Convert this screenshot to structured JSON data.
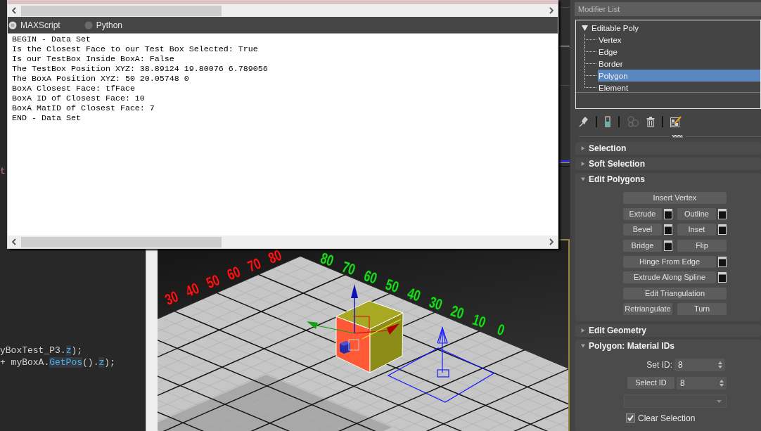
{
  "listener": {
    "tabs": [
      {
        "label": "MAXScript",
        "selected": true
      },
      {
        "label": "Python",
        "selected": false
      }
    ],
    "output": [
      "BEGIN - Data Set",
      "Is the Closest Face to our Test Box Selected: True",
      "Is our TestBox Inside BoxA: False",
      "The TestBox Position XYZ: 38.89124 19.80076 6.789056",
      "The BoxA Position XYZ: 50 20.05748 0",
      "BoxA Closest Face: tfFace",
      "BoxA ID of Closest Face: 10",
      "BoxA MatID of Closest Face: 7",
      "END - Data Set"
    ]
  },
  "code_editor": {
    "upper_lines": [
      [
        {
          "text": "t",
          "kind": "type"
        }
      ]
    ],
    "lower_lines": [
      [
        {
          "text": "yBoxTest_P3.",
          "kind": "plain"
        },
        {
          "text": "z",
          "kind": "member"
        },
        {
          "text": ");",
          "kind": "plain"
        }
      ],
      [
        {
          "text": "+ myBoxA.",
          "kind": "plain"
        },
        {
          "text": "GetPos",
          "kind": "member"
        },
        {
          "text": "().",
          "kind": "plain"
        },
        {
          "text": "z",
          "kind": "member"
        },
        {
          "text": ");",
          "kind": "plain"
        }
      ]
    ]
  },
  "viewport": {
    "left_number_row": [
      "30",
      "40",
      "50",
      "60",
      "70",
      "80"
    ],
    "right_number_row": [
      "80",
      "70",
      "60",
      "50",
      "40",
      "30",
      "20",
      "10",
      "0"
    ]
  },
  "modifier_panel": {
    "modifier_list": {
      "label": "Modifier List"
    },
    "stack": {
      "label": "Editable Poly",
      "expanded": true,
      "selected": false,
      "children": [
        {
          "label": "Vertex",
          "selected": false
        },
        {
          "label": "Edge",
          "selected": false
        },
        {
          "label": "Border",
          "selected": false
        },
        {
          "label": "Polygon",
          "selected": true
        },
        {
          "label": "Element",
          "selected": false
        }
      ]
    },
    "stack_tool_groups": [
      [
        {
          "kind": "pin",
          "disabled": false
        }
      ],
      [
        {
          "kind": "show_result",
          "disabled": false
        }
      ],
      [
        {
          "kind": "make_unique",
          "disabled": true
        },
        {
          "kind": "remove",
          "disabled": false
        }
      ],
      [
        {
          "kind": "configure",
          "disabled": false
        }
      ]
    ],
    "rollouts": [
      {
        "title": "Selection",
        "expanded": false
      },
      {
        "title": "Soft Selection",
        "expanded": false
      },
      {
        "title": "Edit Polygons",
        "expanded": true,
        "kind": "buttons",
        "rows": [
          [
            {
              "label": "Insert Vertex",
              "settings": false
            }
          ],
          [
            {
              "label": "Extrude",
              "settings": true
            },
            {
              "label": "Outline",
              "settings": true
            }
          ],
          [
            {
              "label": "Bevel",
              "settings": true
            },
            {
              "label": "Inset",
              "settings": true
            }
          ],
          [
            {
              "label": "Bridge",
              "settings": true
            },
            {
              "label": "Flip",
              "settings": false
            }
          ],
          [
            {
              "label": "Hinge From Edge",
              "settings": true
            }
          ],
          [
            {
              "label": "Extrude Along Spline",
              "settings": true
            }
          ],
          [
            {
              "label": "Edit Triangulation",
              "settings": false
            }
          ],
          [
            {
              "label": "Retriangulate",
              "settings": false
            },
            {
              "label": "Turn",
              "settings": false
            }
          ]
        ]
      },
      {
        "title": "Edit Geometry",
        "expanded": false
      },
      {
        "title": "Polygon: Material IDs",
        "expanded": true,
        "kind": "material_ids",
        "set_id": {
          "label": "Set ID:",
          "value": "8"
        },
        "select_id": {
          "label": "Select ID",
          "value": "8"
        },
        "clear_selection": {
          "label": "Clear Selection",
          "checked": true
        }
      }
    ]
  }
}
